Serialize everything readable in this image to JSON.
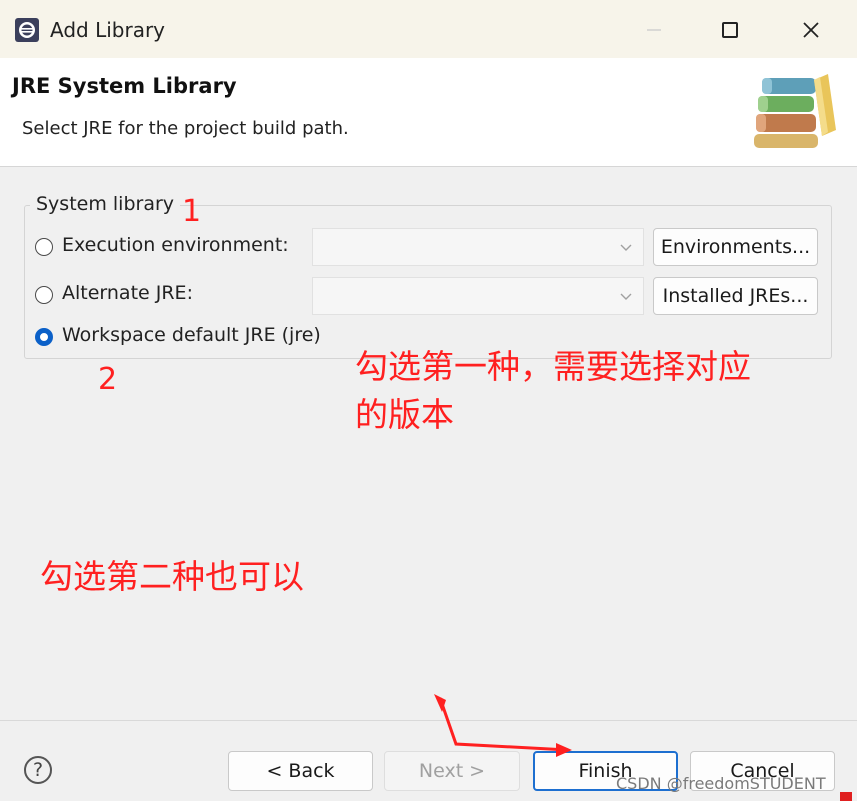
{
  "window": {
    "title": "Add Library",
    "icons": {
      "app": "eclipse-icon",
      "maximize": "maximize-icon",
      "close": "close-icon"
    }
  },
  "header": {
    "title": "JRE System Library",
    "description": "Select JRE for the project build path."
  },
  "group": {
    "label": "System library",
    "options": [
      {
        "label": "Execution environment:",
        "checked": false,
        "combo_value": "",
        "button": "Environments..."
      },
      {
        "label": "Alternate JRE:",
        "checked": false,
        "combo_value": "",
        "button": "Installed JREs..."
      },
      {
        "label": "Workspace default JRE (jre)",
        "checked": true
      }
    ]
  },
  "annotations": {
    "num1": "1",
    "num2": "2",
    "note1_line1": "勾选第一种，需要选择对应",
    "note1_line2": "的版本",
    "note2": "勾选第二种也可以",
    "color": "#ff2020"
  },
  "footer": {
    "back": "< Back",
    "next": "Next >",
    "finish": "Finish",
    "cancel": "Cancel",
    "help": "?"
  },
  "watermark": "CSDN @freedomSTUDENT"
}
